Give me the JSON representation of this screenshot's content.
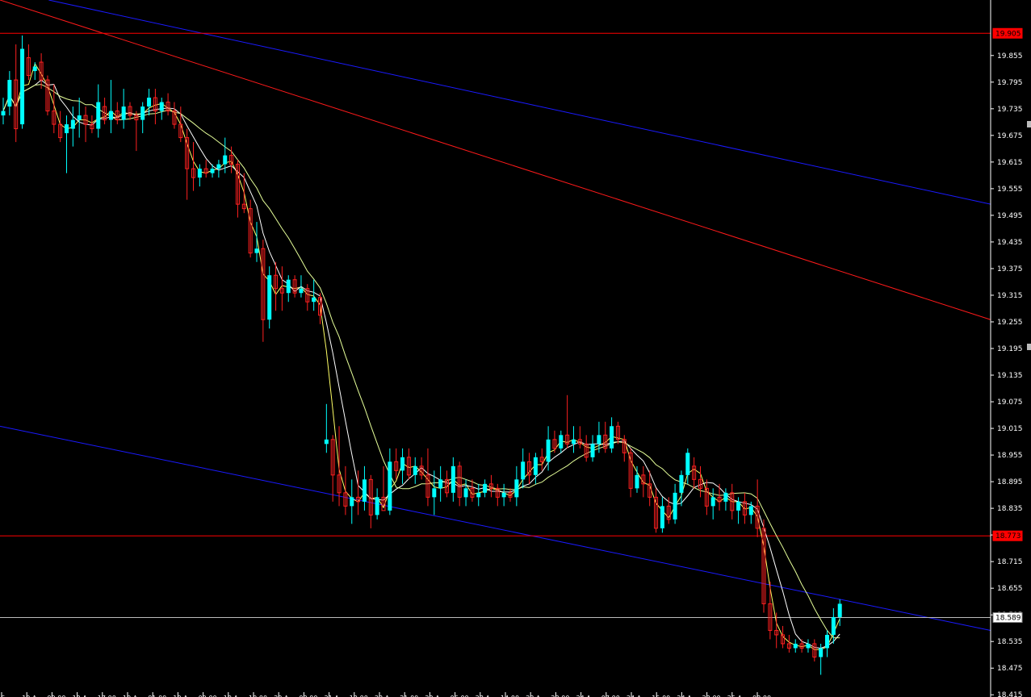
{
  "chart_data": {
    "type": "candlestick",
    "colors": {
      "background": "#000000",
      "bull": "#00ffff",
      "bear": "#ff2020",
      "axis_text": "#ffffff",
      "tag_red": "#ff0000",
      "ma_fast": "#ffff66",
      "ma_mid": "#ffffff",
      "ma_slow": "#e6ff99",
      "channel_blue": "#1a1aff",
      "channel_red": "#ff1a1a"
    },
    "ylim": [
      18.41,
      19.98
    ],
    "xlim": [
      0,
      120
    ],
    "y_ticks": [
      "19.855",
      "19.795",
      "19.735",
      "19.675",
      "19.615",
      "19.555",
      "19.495",
      "19.435",
      "19.375",
      "19.315",
      "19.255",
      "19.195",
      "19.135",
      "19.075",
      "19.015",
      "18.955",
      "18.895",
      "18.835",
      "18.775",
      "18.715",
      "18.655",
      "18.595",
      "18.535",
      "18.475",
      "18.415"
    ],
    "x_labels": [
      "16",
      "10 A",
      "09:00",
      "10 A",
      "17:00",
      "10 A",
      "01:00",
      "10 A",
      "09:00",
      "10 A",
      "10:00",
      "20 A",
      "03:00",
      "21 A",
      "12:00",
      "22 A",
      "21:00",
      "22 A",
      "06:00",
      "23 A",
      "14:00",
      "23 A",
      "23:00",
      "24 A",
      "07:00",
      "24 A",
      "15:00",
      "24 A",
      "23:00",
      "25 A",
      "08:00"
    ],
    "price_tags": [
      {
        "price": 19.905,
        "label": "19.905",
        "style": "red"
      },
      {
        "price": 18.773,
        "label": "18.773",
        "style": "red"
      },
      {
        "price": 18.589,
        "label": "18.589",
        "style": "white"
      }
    ],
    "channel_lines": [
      {
        "color": "blue",
        "from": [
          5.9,
          19.98
        ],
        "to": [
          120,
          19.52
        ]
      },
      {
        "color": "red",
        "from": [
          0,
          19.98
        ],
        "to": [
          120,
          19.26
        ]
      },
      {
        "color": "blue",
        "from": [
          0,
          19.02
        ],
        "to": [
          120,
          18.56
        ]
      }
    ],
    "candles": [
      {
        "o": 19.72,
        "h": 19.76,
        "l": 19.7,
        "c": 19.73
      },
      {
        "o": 19.74,
        "h": 19.82,
        "l": 19.72,
        "c": 19.8
      },
      {
        "o": 19.8,
        "h": 19.88,
        "l": 19.66,
        "c": 19.69
      },
      {
        "o": 19.7,
        "h": 19.9,
        "l": 19.69,
        "c": 19.87
      },
      {
        "o": 19.85,
        "h": 19.88,
        "l": 19.8,
        "c": 19.81
      },
      {
        "o": 19.82,
        "h": 19.84,
        "l": 19.8,
        "c": 19.83
      },
      {
        "o": 19.84,
        "h": 19.86,
        "l": 19.78,
        "c": 19.8
      },
      {
        "o": 19.8,
        "h": 19.81,
        "l": 19.72,
        "c": 19.73
      },
      {
        "o": 19.73,
        "h": 19.79,
        "l": 19.68,
        "c": 19.7
      },
      {
        "o": 19.7,
        "h": 19.73,
        "l": 19.66,
        "c": 19.67
      },
      {
        "o": 19.68,
        "h": 19.72,
        "l": 19.59,
        "c": 19.7
      },
      {
        "o": 19.69,
        "h": 19.74,
        "l": 19.65,
        "c": 19.71
      },
      {
        "o": 19.71,
        "h": 19.76,
        "l": 19.67,
        "c": 19.72
      },
      {
        "o": 19.72,
        "h": 19.74,
        "l": 19.66,
        "c": 19.7
      },
      {
        "o": 19.7,
        "h": 19.72,
        "l": 19.68,
        "c": 19.69
      },
      {
        "o": 19.69,
        "h": 19.79,
        "l": 19.67,
        "c": 19.75
      },
      {
        "o": 19.74,
        "h": 19.76,
        "l": 19.7,
        "c": 19.71
      },
      {
        "o": 19.71,
        "h": 19.8,
        "l": 19.68,
        "c": 19.73
      },
      {
        "o": 19.73,
        "h": 19.75,
        "l": 19.7,
        "c": 19.71
      },
      {
        "o": 19.71,
        "h": 19.78,
        "l": 19.69,
        "c": 19.74
      },
      {
        "o": 19.74,
        "h": 19.75,
        "l": 19.71,
        "c": 19.72
      },
      {
        "o": 19.72,
        "h": 19.73,
        "l": 19.64,
        "c": 19.71
      },
      {
        "o": 19.71,
        "h": 19.75,
        "l": 19.68,
        "c": 19.74
      },
      {
        "o": 19.74,
        "h": 19.78,
        "l": 19.72,
        "c": 19.76
      },
      {
        "o": 19.76,
        "h": 19.78,
        "l": 19.7,
        "c": 19.73
      },
      {
        "o": 19.73,
        "h": 19.76,
        "l": 19.71,
        "c": 19.75
      },
      {
        "o": 19.75,
        "h": 19.77,
        "l": 19.72,
        "c": 19.73
      },
      {
        "o": 19.73,
        "h": 19.75,
        "l": 19.69,
        "c": 19.7
      },
      {
        "o": 19.7,
        "h": 19.74,
        "l": 19.66,
        "c": 19.67
      },
      {
        "o": 19.67,
        "h": 19.69,
        "l": 19.53,
        "c": 19.6
      },
      {
        "o": 19.6,
        "h": 19.66,
        "l": 19.55,
        "c": 19.58
      },
      {
        "o": 19.58,
        "h": 19.61,
        "l": 19.56,
        "c": 19.6
      },
      {
        "o": 19.6,
        "h": 19.62,
        "l": 19.58,
        "c": 19.59
      },
      {
        "o": 19.59,
        "h": 19.61,
        "l": 19.58,
        "c": 19.6
      },
      {
        "o": 19.6,
        "h": 19.62,
        "l": 19.58,
        "c": 19.61
      },
      {
        "o": 19.61,
        "h": 19.67,
        "l": 19.59,
        "c": 19.63
      },
      {
        "o": 19.63,
        "h": 19.65,
        "l": 19.59,
        "c": 19.61
      },
      {
        "o": 19.61,
        "h": 19.62,
        "l": 19.49,
        "c": 19.52
      },
      {
        "o": 19.52,
        "h": 19.59,
        "l": 19.5,
        "c": 19.51
      },
      {
        "o": 19.51,
        "h": 19.53,
        "l": 19.4,
        "c": 19.41
      },
      {
        "o": 19.41,
        "h": 19.48,
        "l": 19.39,
        "c": 19.42
      },
      {
        "o": 19.42,
        "h": 19.44,
        "l": 19.21,
        "c": 19.26
      },
      {
        "o": 19.26,
        "h": 19.38,
        "l": 19.24,
        "c": 19.36
      },
      {
        "o": 19.36,
        "h": 19.39,
        "l": 19.28,
        "c": 19.33
      },
      {
        "o": 19.33,
        "h": 19.38,
        "l": 19.28,
        "c": 19.32
      },
      {
        "o": 19.32,
        "h": 19.36,
        "l": 19.3,
        "c": 19.35
      },
      {
        "o": 19.35,
        "h": 19.36,
        "l": 19.31,
        "c": 19.32
      },
      {
        "o": 19.32,
        "h": 19.36,
        "l": 19.31,
        "c": 19.33
      },
      {
        "o": 19.33,
        "h": 19.34,
        "l": 19.28,
        "c": 19.3
      },
      {
        "o": 19.3,
        "h": 19.35,
        "l": 19.28,
        "c": 19.31
      },
      {
        "o": 19.31,
        "h": 19.32,
        "l": 19.25,
        "c": 19.27
      },
      {
        "o": 18.98,
        "h": 19.07,
        "l": 18.96,
        "c": 18.99
      },
      {
        "o": 18.99,
        "h": 19.0,
        "l": 18.85,
        "c": 18.91
      },
      {
        "o": 18.91,
        "h": 19.02,
        "l": 18.84,
        "c": 18.87
      },
      {
        "o": 18.87,
        "h": 18.93,
        "l": 18.82,
        "c": 18.84
      },
      {
        "o": 18.84,
        "h": 18.9,
        "l": 18.8,
        "c": 18.86
      },
      {
        "o": 18.86,
        "h": 18.92,
        "l": 18.82,
        "c": 18.85
      },
      {
        "o": 18.85,
        "h": 18.93,
        "l": 18.83,
        "c": 18.9
      },
      {
        "o": 18.9,
        "h": 18.91,
        "l": 18.79,
        "c": 18.82
      },
      {
        "o": 18.82,
        "h": 18.88,
        "l": 18.81,
        "c": 18.86
      },
      {
        "o": 18.86,
        "h": 18.93,
        "l": 18.84,
        "c": 18.83
      },
      {
        "o": 18.83,
        "h": 18.97,
        "l": 18.82,
        "c": 18.94
      },
      {
        "o": 18.94,
        "h": 18.97,
        "l": 18.9,
        "c": 18.92
      },
      {
        "o": 18.92,
        "h": 18.97,
        "l": 18.89,
        "c": 18.95
      },
      {
        "o": 18.95,
        "h": 18.97,
        "l": 18.9,
        "c": 18.91
      },
      {
        "o": 18.91,
        "h": 18.95,
        "l": 18.89,
        "c": 18.93
      },
      {
        "o": 18.93,
        "h": 18.95,
        "l": 18.9,
        "c": 18.91
      },
      {
        "o": 18.91,
        "h": 18.97,
        "l": 18.84,
        "c": 18.86
      },
      {
        "o": 18.86,
        "h": 18.92,
        "l": 18.82,
        "c": 18.88
      },
      {
        "o": 18.88,
        "h": 18.93,
        "l": 18.85,
        "c": 18.9
      },
      {
        "o": 18.9,
        "h": 18.92,
        "l": 18.86,
        "c": 18.87
      },
      {
        "o": 18.87,
        "h": 18.95,
        "l": 18.85,
        "c": 18.93
      },
      {
        "o": 18.93,
        "h": 18.94,
        "l": 18.84,
        "c": 18.86
      },
      {
        "o": 18.86,
        "h": 18.9,
        "l": 18.84,
        "c": 18.88
      },
      {
        "o": 18.88,
        "h": 18.9,
        "l": 18.85,
        "c": 18.86
      },
      {
        "o": 18.86,
        "h": 18.89,
        "l": 18.84,
        "c": 18.87
      },
      {
        "o": 18.87,
        "h": 18.9,
        "l": 18.86,
        "c": 18.89
      },
      {
        "o": 18.89,
        "h": 18.91,
        "l": 18.86,
        "c": 18.88
      },
      {
        "o": 18.88,
        "h": 18.89,
        "l": 18.84,
        "c": 18.86
      },
      {
        "o": 18.86,
        "h": 18.89,
        "l": 18.84,
        "c": 18.87
      },
      {
        "o": 18.87,
        "h": 18.88,
        "l": 18.85,
        "c": 18.86
      },
      {
        "o": 18.86,
        "h": 18.93,
        "l": 18.84,
        "c": 18.9
      },
      {
        "o": 18.9,
        "h": 18.97,
        "l": 18.88,
        "c": 18.94
      },
      {
        "o": 18.94,
        "h": 18.96,
        "l": 18.89,
        "c": 18.91
      },
      {
        "o": 18.91,
        "h": 18.96,
        "l": 18.89,
        "c": 18.95
      },
      {
        "o": 18.95,
        "h": 18.97,
        "l": 18.92,
        "c": 18.94
      },
      {
        "o": 18.94,
        "h": 19.02,
        "l": 18.92,
        "c": 18.99
      },
      {
        "o": 18.99,
        "h": 19.01,
        "l": 18.96,
        "c": 18.97
      },
      {
        "o": 18.97,
        "h": 19.01,
        "l": 18.96,
        "c": 19.0
      },
      {
        "o": 19.0,
        "h": 19.09,
        "l": 18.97,
        "c": 18.98
      },
      {
        "o": 18.98,
        "h": 19.02,
        "l": 18.96,
        "c": 18.99
      },
      {
        "o": 18.99,
        "h": 19.02,
        "l": 18.97,
        "c": 18.98
      },
      {
        "o": 18.98,
        "h": 19.0,
        "l": 18.94,
        "c": 18.95
      },
      {
        "o": 18.95,
        "h": 19.0,
        "l": 18.94,
        "c": 18.98
      },
      {
        "o": 18.98,
        "h": 19.03,
        "l": 18.96,
        "c": 19.0
      },
      {
        "o": 19.0,
        "h": 19.03,
        "l": 18.96,
        "c": 18.97
      },
      {
        "o": 18.97,
        "h": 19.04,
        "l": 18.96,
        "c": 19.02
      },
      {
        "o": 19.02,
        "h": 19.03,
        "l": 18.98,
        "c": 18.99
      },
      {
        "o": 18.99,
        "h": 19.0,
        "l": 18.94,
        "c": 18.96
      },
      {
        "o": 18.96,
        "h": 18.97,
        "l": 18.86,
        "c": 18.88
      },
      {
        "o": 18.88,
        "h": 18.93,
        "l": 18.87,
        "c": 18.91
      },
      {
        "o": 18.91,
        "h": 18.93,
        "l": 18.86,
        "c": 18.89
      },
      {
        "o": 18.89,
        "h": 18.92,
        "l": 18.84,
        "c": 18.86
      },
      {
        "o": 18.86,
        "h": 18.88,
        "l": 18.78,
        "c": 18.79
      },
      {
        "o": 18.79,
        "h": 18.86,
        "l": 18.78,
        "c": 18.84
      },
      {
        "o": 18.84,
        "h": 18.86,
        "l": 18.8,
        "c": 18.81
      },
      {
        "o": 18.81,
        "h": 18.89,
        "l": 18.8,
        "c": 18.87
      },
      {
        "o": 18.87,
        "h": 18.92,
        "l": 18.84,
        "c": 18.91
      },
      {
        "o": 18.91,
        "h": 18.97,
        "l": 18.89,
        "c": 18.96
      },
      {
        "o": 18.93,
        "h": 18.95,
        "l": 18.88,
        "c": 18.9
      },
      {
        "o": 18.9,
        "h": 18.93,
        "l": 18.86,
        "c": 18.88
      },
      {
        "o": 18.88,
        "h": 18.9,
        "l": 18.82,
        "c": 18.84
      },
      {
        "o": 18.84,
        "h": 18.88,
        "l": 18.81,
        "c": 18.86
      },
      {
        "o": 18.86,
        "h": 18.89,
        "l": 18.83,
        "c": 18.85
      },
      {
        "o": 18.85,
        "h": 18.88,
        "l": 18.83,
        "c": 18.87
      },
      {
        "o": 18.87,
        "h": 18.89,
        "l": 18.81,
        "c": 18.83
      },
      {
        "o": 18.83,
        "h": 18.86,
        "l": 18.8,
        "c": 18.85
      },
      {
        "o": 18.85,
        "h": 18.87,
        "l": 18.8,
        "c": 18.82
      },
      {
        "o": 18.82,
        "h": 18.85,
        "l": 18.8,
        "c": 18.84
      },
      {
        "o": 18.84,
        "h": 18.9,
        "l": 18.77,
        "c": 18.79
      }
    ],
    "candles_tail": [
      {
        "o": 18.79,
        "h": 18.81,
        "l": 18.6,
        "c": 18.62
      },
      {
        "o": 18.62,
        "h": 18.67,
        "l": 18.54,
        "c": 18.56
      },
      {
        "o": 18.56,
        "h": 18.6,
        "l": 18.52,
        "c": 18.55
      },
      {
        "o": 18.55,
        "h": 18.57,
        "l": 18.52,
        "c": 18.53
      },
      {
        "o": 18.53,
        "h": 18.55,
        "l": 18.51,
        "c": 18.52
      },
      {
        "o": 18.52,
        "h": 18.54,
        "l": 18.51,
        "c": 18.53
      },
      {
        "o": 18.53,
        "h": 18.54,
        "l": 18.51,
        "c": 18.52
      },
      {
        "o": 18.52,
        "h": 18.54,
        "l": 18.51,
        "c": 18.53
      },
      {
        "o": 18.53,
        "h": 18.54,
        "l": 18.49,
        "c": 18.5
      },
      {
        "o": 18.5,
        "h": 18.53,
        "l": 18.46,
        "c": 18.52
      },
      {
        "o": 18.52,
        "h": 18.56,
        "l": 18.5,
        "c": 18.55
      },
      {
        "o": 18.55,
        "h": 18.61,
        "l": 18.53,
        "c": 18.59
      },
      {
        "o": 18.59,
        "h": 18.63,
        "l": 18.57,
        "c": 18.62
      }
    ]
  }
}
